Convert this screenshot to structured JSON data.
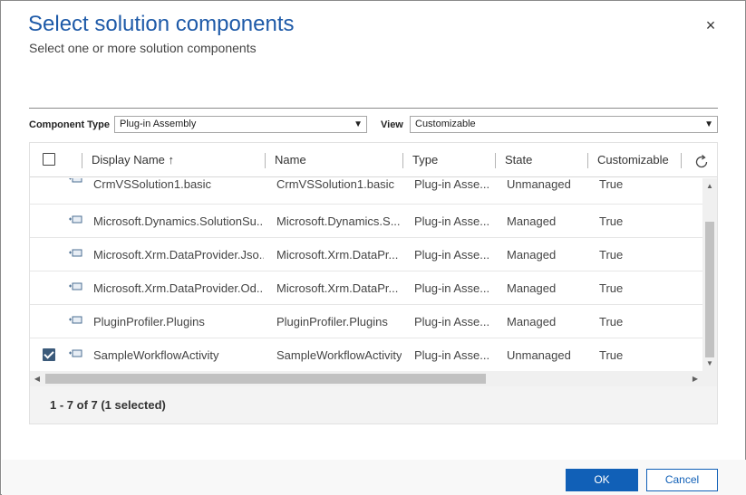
{
  "dialog": {
    "title": "Select solution components",
    "subtitle": "Select one or more solution components",
    "close_symbol": "×"
  },
  "filters": {
    "component_type_label": "Component Type",
    "component_type_value": "Plug-in Assembly",
    "view_label": "View",
    "view_value": "Customizable"
  },
  "grid": {
    "columns": [
      {
        "label": "Display Name ↑"
      },
      {
        "label": "Name"
      },
      {
        "label": "Type"
      },
      {
        "label": "State"
      },
      {
        "label": "Customizable"
      }
    ],
    "rows": [
      {
        "display_name": "CrmVSSolution1.basic",
        "name": "CrmVSSolution1.basic",
        "type": "Plug-in Asse...",
        "state": "Unmanaged",
        "customizable": "True",
        "checked": false
      },
      {
        "display_name": "Microsoft.Dynamics.SolutionSu...",
        "name": "Microsoft.Dynamics.S...",
        "type": "Plug-in Asse...",
        "state": "Managed",
        "customizable": "True",
        "checked": false
      },
      {
        "display_name": "Microsoft.Xrm.DataProvider.Jso...",
        "name": "Microsoft.Xrm.DataPr...",
        "type": "Plug-in Asse...",
        "state": "Managed",
        "customizable": "True",
        "checked": false
      },
      {
        "display_name": "Microsoft.Xrm.DataProvider.Od...",
        "name": "Microsoft.Xrm.DataPr...",
        "type": "Plug-in Asse...",
        "state": "Managed",
        "customizable": "True",
        "checked": false
      },
      {
        "display_name": "PluginProfiler.Plugins",
        "name": "PluginProfiler.Plugins",
        "type": "Plug-in Asse...",
        "state": "Managed",
        "customizable": "True",
        "checked": false
      },
      {
        "display_name": "SampleWorkflowActivity",
        "name": "SampleWorkflowActivity",
        "type": "Plug-in Asse...",
        "state": "Unmanaged",
        "customizable": "True",
        "checked": true
      }
    ],
    "footer": "1 - 7 of 7 (1 selected)"
  },
  "buttons": {
    "ok": "OK",
    "cancel": "Cancel"
  },
  "colors": {
    "title": "#1e5aa8",
    "primary_button": "#1160b7",
    "checked_box": "#3b5a7a"
  }
}
